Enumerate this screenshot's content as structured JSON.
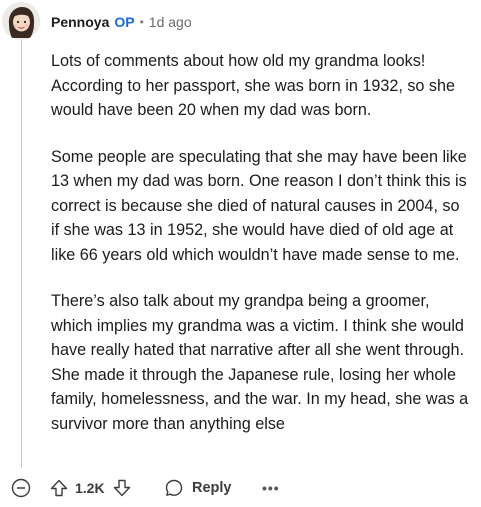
{
  "comment": {
    "username": "Pennoya",
    "op_badge": "OP",
    "separator": "•",
    "timestamp": "1d ago",
    "avatar_icon": "snoo-avatar-icon",
    "paragraphs": [
      "Lots of comments about how old my grandma looks! According to her passport, she was born in 1932, so she would have been 20 when my dad was born.",
      "Some people are speculating that she may have been like 13 when my dad was born. One reason I don’t think this is correct is because she died of natural causes in 2004, so if she was 13 in 1952, she would have died of old age at like 66 years old which wouldn’t have made sense to me.",
      "There’s also talk about my grandpa being a groomer, which implies my grandma was a victim. I think she would have really hated that narrative after all she went through. She made it through the Japanese rule, losing her whole family, homelessness, and the war. In my head, she was a survivor more than anything else"
    ]
  },
  "actions": {
    "collapse_icon": "collapse-minus-icon",
    "upvote_icon": "upvote-arrow-icon",
    "vote_count": "1.2K",
    "downvote_icon": "downvote-arrow-icon",
    "reply_icon": "comment-bubble-icon",
    "reply_label": "Reply",
    "more_label": "•••"
  },
  "colors": {
    "op_blue": "#1a6ad6",
    "thread_line": "#d7c98f",
    "text": "#1c1c1c"
  }
}
